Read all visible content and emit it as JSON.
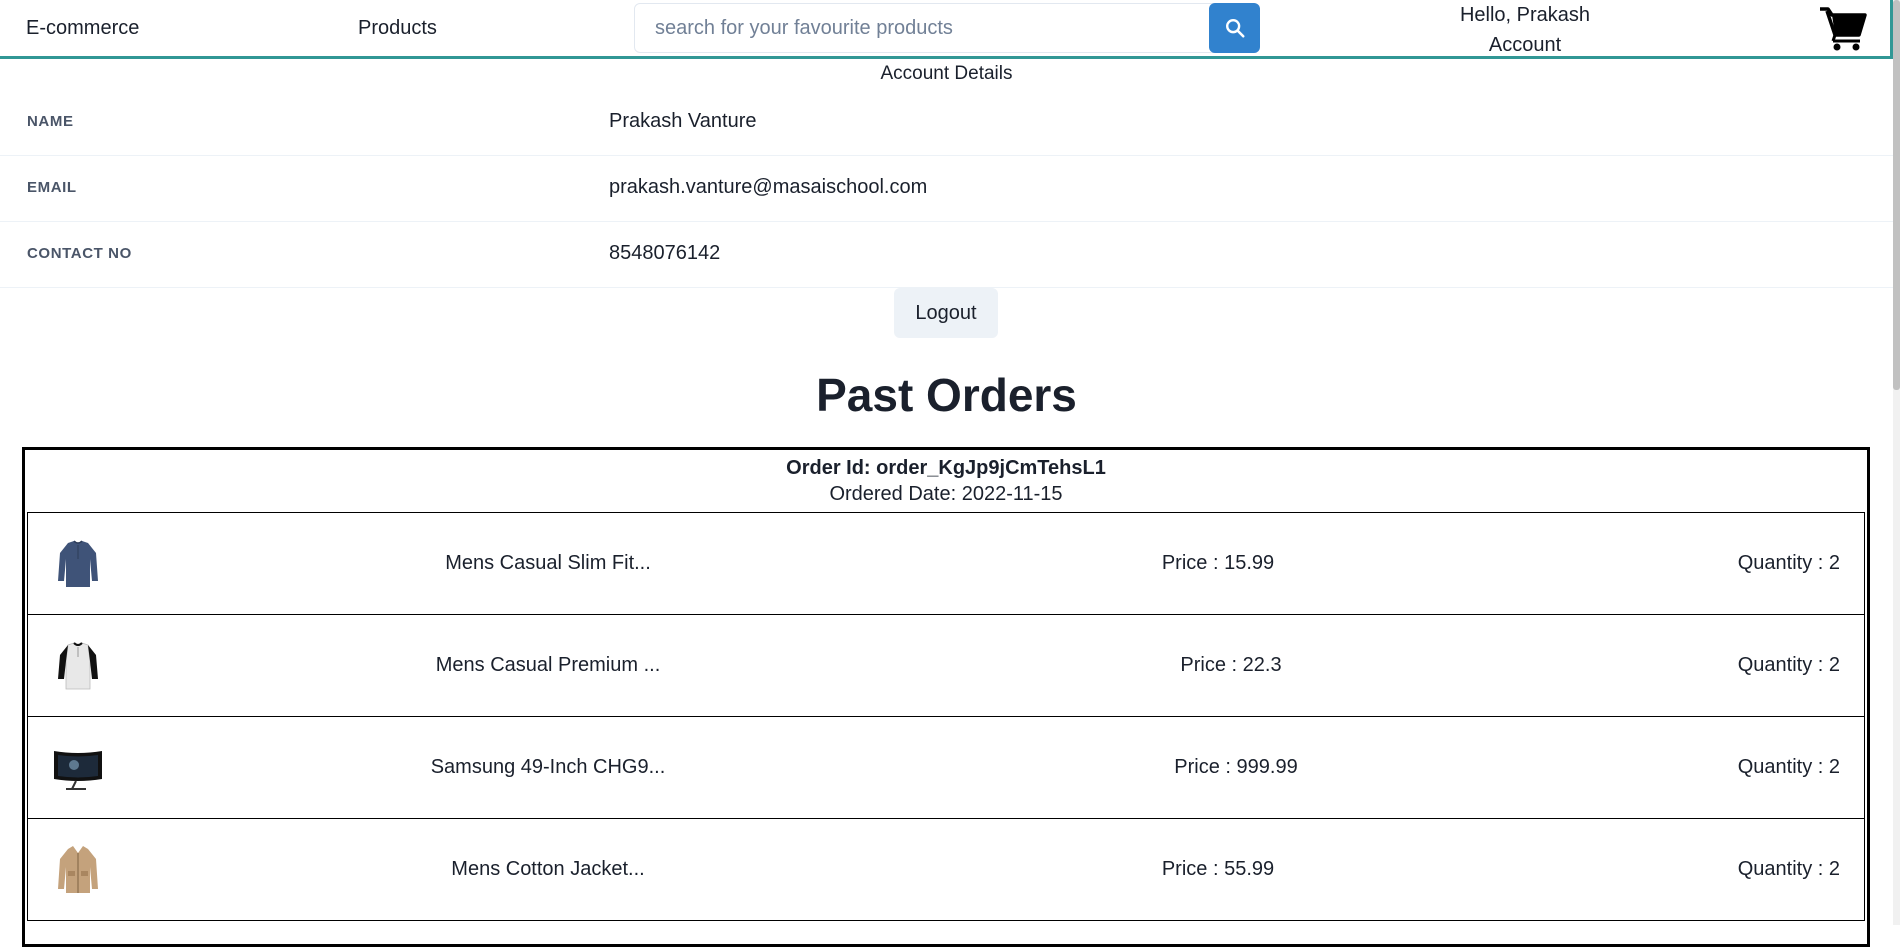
{
  "navbar": {
    "brand": "E-commerce",
    "products_link": "Products",
    "search": {
      "placeholder": "search for your favourite products",
      "value": "",
      "button_icon": "search-icon"
    },
    "greeting": "Hello, Prakash",
    "account_link": "Account",
    "cart_icon": "cart-icon"
  },
  "account": {
    "title": "Account Details",
    "fields": [
      {
        "label": "NAME",
        "value": "Prakash Vanture"
      },
      {
        "label": "EMAIL",
        "value": "prakash.vanture@masaischool.com"
      },
      {
        "label": "CONTACT NO",
        "value": "8548076142"
      }
    ],
    "logout_label": "Logout"
  },
  "orders": {
    "title": "Past Orders",
    "list": [
      {
        "order_id_text": "Order Id: order_KgJp9jCmTehsL1",
        "date_text": "Ordered Date: 2022-11-15",
        "items": [
          {
            "name": "Mens Casual Slim Fit...",
            "price": "Price : 15.99",
            "quantity": "Quantity : 2",
            "thumb": "blue-long-sleeve-shirt"
          },
          {
            "name": "Mens Casual Premium ...",
            "price": "Price : 22.3",
            "quantity": "Quantity : 2",
            "thumb": "raglan-tshirt"
          },
          {
            "name": "Samsung 49-Inch CHG9...",
            "price": "Price : 999.99",
            "quantity": "Quantity : 2",
            "thumb": "curved-monitor"
          },
          {
            "name": "Mens Cotton Jacket...",
            "price": "Price : 55.99",
            "quantity": "Quantity : 2",
            "thumb": "beige-jacket"
          }
        ]
      }
    ]
  },
  "colors": {
    "accent_teal": "#319795",
    "search_button": "#3182ce",
    "logout_bg": "#edf2f7"
  }
}
